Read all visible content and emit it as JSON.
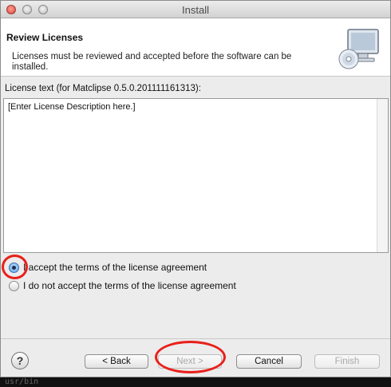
{
  "window": {
    "title": "Install"
  },
  "header": {
    "title": "Review Licenses",
    "description": "Licenses must be reviewed and accepted before the software can be installed.",
    "icon": "install-cd-monitor-icon"
  },
  "license": {
    "label": "License text (for Matclipse 0.5.0.201111161313):",
    "text": "[Enter License Description here.]"
  },
  "options": {
    "accept_label": "I accept the terms of the license agreement",
    "decline_label": "I do not accept the terms of the license agreement",
    "selected": "accept"
  },
  "buttons": {
    "help": "?",
    "back": "< Back",
    "next": "Next >",
    "cancel": "Cancel",
    "finish": "Finish"
  },
  "annotations": {
    "highlight_color": "#e8201b"
  },
  "background": {
    "terminal_fragment": "usr/bin"
  }
}
